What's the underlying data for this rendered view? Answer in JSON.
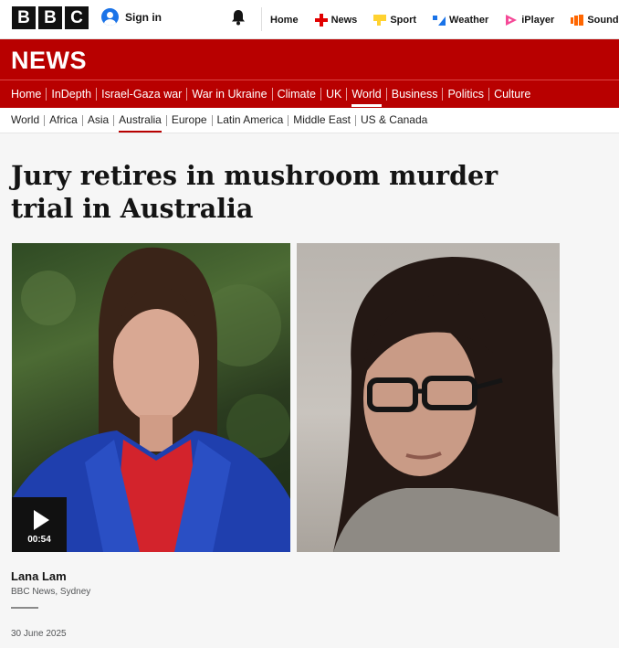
{
  "header": {
    "logo_letters": [
      "B",
      "B",
      "C"
    ],
    "signin_label": "Sign in",
    "nav": [
      {
        "label": "Home",
        "icon": "none"
      },
      {
        "label": "News",
        "icon": "news-icon",
        "color": "#e10000"
      },
      {
        "label": "Sport",
        "icon": "sport-icon",
        "color": "#ffd230"
      },
      {
        "label": "Weather",
        "icon": "weather-icon",
        "color": "#1a73e8"
      },
      {
        "label": "iPlayer",
        "icon": "iplayer-icon",
        "color": "#f54997"
      },
      {
        "label": "Sounds",
        "icon": "sounds-icon",
        "color": "#ff6600"
      }
    ]
  },
  "news_banner": {
    "wordmark": "NEWS",
    "color": "#b80000"
  },
  "section_nav": [
    {
      "label": "Home"
    },
    {
      "label": "InDepth"
    },
    {
      "label": "Israel-Gaza war"
    },
    {
      "label": "War in Ukraine"
    },
    {
      "label": "Climate"
    },
    {
      "label": "UK"
    },
    {
      "label": "World",
      "active": true
    },
    {
      "label": "Business"
    },
    {
      "label": "Politics"
    },
    {
      "label": "Culture"
    }
  ],
  "sub_nav": [
    {
      "label": "World"
    },
    {
      "label": "Africa"
    },
    {
      "label": "Asia"
    },
    {
      "label": "Australia",
      "active": true
    },
    {
      "label": "Europe"
    },
    {
      "label": "Latin America"
    },
    {
      "label": "Middle East"
    },
    {
      "label": "US & Canada"
    }
  ],
  "article": {
    "headline": "Jury retires in mushroom murder trial in Australia",
    "video_duration": "00:54",
    "author_name": "Lana Lam",
    "author_role": "BBC News, Sydney",
    "date": "30 June 2025"
  }
}
